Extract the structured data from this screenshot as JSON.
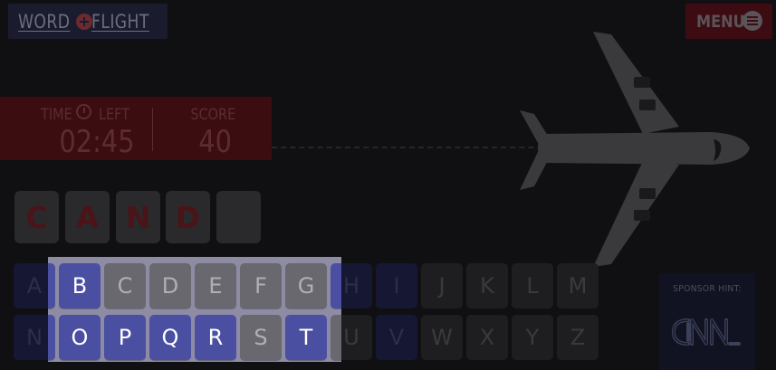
{
  "header": {
    "logo_word_1": "WORD",
    "logo_word_2": "FLIGHT",
    "menu_label": "MENU"
  },
  "stats": {
    "time_label_1": "TIME",
    "time_label_2": "LEFT",
    "time_value": "02:45",
    "score_label": "SCORE",
    "score_value": "40"
  },
  "answer": {
    "letters": [
      "C",
      "A",
      "N",
      "D",
      ""
    ]
  },
  "keyboard": {
    "row1": [
      "A",
      "B",
      "C",
      "D",
      "E",
      "F",
      "G",
      "H",
      "I",
      "J",
      "K",
      "L",
      "M"
    ],
    "row2": [
      "N",
      "O",
      "P",
      "Q",
      "R",
      "S",
      "T",
      "U",
      "V",
      "W",
      "X",
      "Y",
      "Z"
    ],
    "used_letters": [
      "A",
      "B",
      "H",
      "I",
      "N",
      "O",
      "P",
      "Q",
      "R",
      "T",
      "V"
    ]
  },
  "sponsor": {
    "label": "SPONSOR HINT:",
    "logo_name": "cnn-logo"
  },
  "colors": {
    "used_key": "#4a4fa2",
    "plain_key": "#68686e",
    "spotlight_bg": "#8e8ca4",
    "stats_bg": "#3b0c10",
    "menu_bg": "#3d0c12"
  }
}
